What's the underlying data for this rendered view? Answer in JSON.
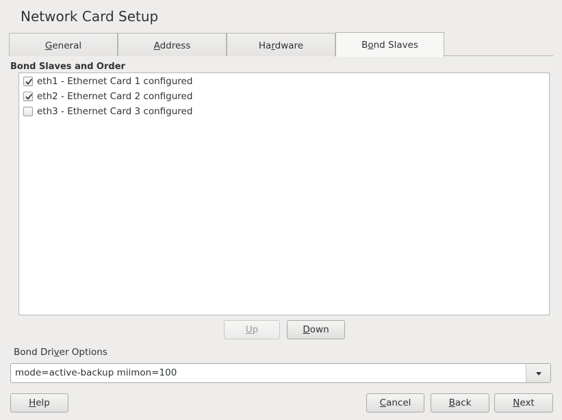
{
  "window": {
    "title": "Network Card Setup"
  },
  "tabs": [
    {
      "label": "General",
      "mnemonic_index": 0
    },
    {
      "label": "Address",
      "mnemonic_index": 0
    },
    {
      "label": "Hardware",
      "mnemonic_index": 2
    },
    {
      "label": "Bond Slaves",
      "mnemonic_index": 1,
      "active": true
    }
  ],
  "bond_slaves": {
    "section_label": "Bond Slaves and Order",
    "items": [
      {
        "label": "eth1 - Ethernet Card 1 configured",
        "checked": true
      },
      {
        "label": "eth2 - Ethernet Card 2 configured",
        "checked": true
      },
      {
        "label": "eth3 - Ethernet Card 3 configured",
        "checked": false
      }
    ],
    "up_label": "Up",
    "down_label": "Down"
  },
  "driver_options": {
    "label": "Bond Driver Options",
    "value": "mode=active-backup miimon=100"
  },
  "footer": {
    "help_label": "Help",
    "cancel_label": "Cancel",
    "back_label": "Back",
    "next_label": "Next"
  },
  "colors": {
    "background": "#eeedec",
    "border": "#b6b6b3",
    "text": "#2e3436",
    "disabled_text": "#9a9a98"
  }
}
